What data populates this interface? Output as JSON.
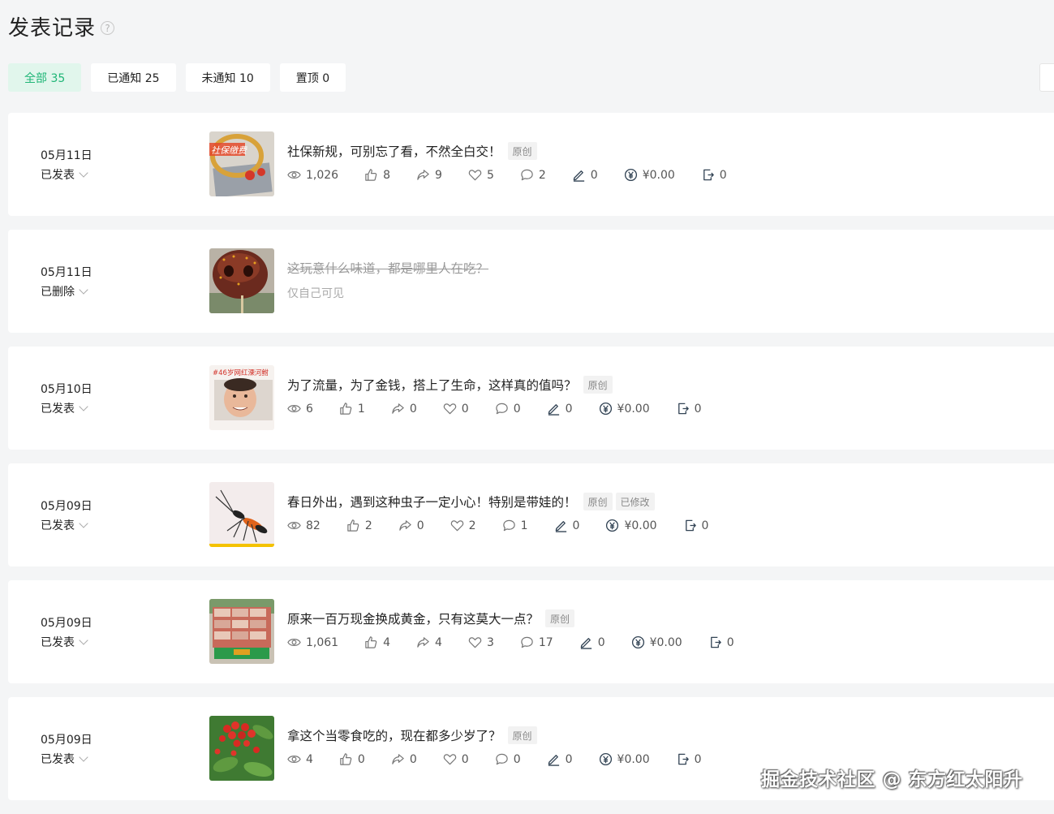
{
  "header": {
    "title": "发表记录",
    "help_icon": "question-circle-icon"
  },
  "tabs": [
    {
      "label": "全部 35",
      "active": true
    },
    {
      "label": "已通知 25",
      "active": false
    },
    {
      "label": "未通知 10",
      "active": false
    },
    {
      "label": "置顶 0",
      "active": false
    }
  ],
  "posts": [
    {
      "date": "05月11日",
      "status": "已发表",
      "title": "社保新规，可别忘了看，不然全白交！",
      "tags": [
        "原创"
      ],
      "stats": {
        "views": "1,026",
        "likes": "8",
        "shares": "9",
        "favorites": "5",
        "comments": "2",
        "edits": "0",
        "income": "¥0.00",
        "exports": "0"
      }
    },
    {
      "date": "05月11日",
      "status": "已删除",
      "title": "这玩意什么味道，都是哪里人在吃？",
      "note": "仅自己可见"
    },
    {
      "date": "05月10日",
      "status": "已发表",
      "title": "为了流量，为了金钱，搭上了生命，这样真的值吗？",
      "tags": [
        "原创"
      ],
      "thumb_caption": "#46岁网红溧河鲋",
      "stats": {
        "views": "6",
        "likes": "1",
        "shares": "0",
        "favorites": "0",
        "comments": "0",
        "edits": "0",
        "income": "¥0.00",
        "exports": "0"
      }
    },
    {
      "date": "05月09日",
      "status": "已发表",
      "title": "春日外出，遇到这种虫子一定小心！特别是带娃的！",
      "tags": [
        "原创",
        "已修改"
      ],
      "stats": {
        "views": "82",
        "likes": "2",
        "shares": "0",
        "favorites": "2",
        "comments": "1",
        "edits": "0",
        "income": "¥0.00",
        "exports": "0"
      }
    },
    {
      "date": "05月09日",
      "status": "已发表",
      "title": "原来一百万现金换成黄金，只有这莫大一点？",
      "tags": [
        "原创"
      ],
      "stats": {
        "views": "1,061",
        "likes": "4",
        "shares": "4",
        "favorites": "3",
        "comments": "17",
        "edits": "0",
        "income": "¥0.00",
        "exports": "0"
      }
    },
    {
      "date": "05月09日",
      "status": "已发表",
      "title": "拿这个当零食吃的，现在都多少岁了？",
      "tags": [
        "原创"
      ],
      "stats": {
        "views": "4",
        "likes": "0",
        "shares": "0",
        "favorites": "0",
        "comments": "0",
        "edits": "0",
        "income": "¥0.00",
        "exports": "0"
      }
    }
  ],
  "watermark": "掘金技术社区 @ 东方红太阳升",
  "colors": {
    "accent": "#1fb576",
    "accent_bg": "#e1f6ec",
    "page_bg": "#f4f5f6"
  }
}
